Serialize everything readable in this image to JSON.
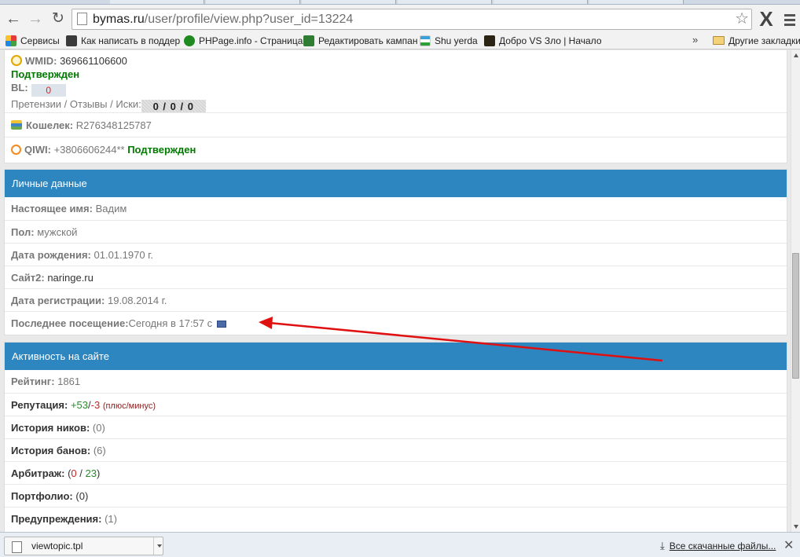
{
  "browser": {
    "url_host": "bymas.ru",
    "url_path": "/user/profile/view.php?user_id=13224",
    "bookmarks": [
      {
        "label": "Сервисы",
        "icon": "apps-grid-icon",
        "color": "#d9534f"
      },
      {
        "label": "Как написать в поддер",
        "icon": "gmail-icon",
        "color": "#3a3a3a"
      },
      {
        "label": "PHPage.info - Страница",
        "icon": "phpage-icon",
        "color": "#1f8a1f"
      },
      {
        "label": "Редактировать кампан",
        "icon": "edit-campaign-icon",
        "color": "#2e7d32"
      },
      {
        "label": "Shu yerda",
        "icon": "uzbek-flag-icon",
        "color": "#3aa0d8"
      },
      {
        "label": "Добро VS Зло | Начало",
        "icon": "dobro-zlo-icon",
        "color": "#4a3a20"
      }
    ],
    "more_glyph": "»",
    "other_bookmarks": "Другие закладки"
  },
  "top_section": {
    "wmid_label": "WMID:",
    "wmid_value": "369661106600",
    "wmid_status": "Подтвержден",
    "bl_label": "BL:",
    "bl_value": "0",
    "claims_label": "Претензии / Отзывы / Иски:",
    "claims_value": "0 / 0 / 0",
    "wallet_label": "Кошелек:",
    "wallet_value": "R276348125787",
    "qiwi_label": "QIWI:",
    "qiwi_value": "+3806606244**",
    "qiwi_status": "Подтвержден"
  },
  "personal": {
    "heading": "Личные данные",
    "real_name_label": "Настоящее имя:",
    "real_name_value": "Вадим",
    "gender_label": "Пол:",
    "gender_value": "мужской",
    "birth_label": "Дата рождения:",
    "birth_value": "01.01.1970 г.",
    "site_label": "Сайт2:",
    "site_value": "naringe.ru",
    "reg_label": "Дата регистрации:",
    "reg_value": "19.08.2014 г.",
    "last_visit_label": "Последнее посещение:",
    "last_visit_value": "Сегодня в 17:57 с"
  },
  "activity": {
    "heading": "Активность на сайте",
    "rating_label": "Рейтинг:",
    "rating_value": "1861",
    "reputation_label": "Репутация:",
    "reputation_plus": "+53",
    "reputation_slash": "/",
    "reputation_minus": "-3",
    "reputation_note": "(плюс/минус)",
    "nick_history_label": "История ников:",
    "nick_history_value": "(0)",
    "ban_history_label": "История банов:",
    "ban_history_value": "(6)",
    "arbitration_label": "Арбитраж:",
    "arbitration_open": "(",
    "arbitration_lost": "0",
    "arbitration_sep": " / ",
    "arbitration_total": "23",
    "arbitration_close": ")",
    "portfolio_label": "Портфолио:",
    "portfolio_value": "(0)",
    "warnings_label": "Предупреждения:",
    "warnings_value": "(1)"
  },
  "downloads": {
    "file_name": "viewtopic.tpl",
    "all_downloads": "Все скачанные файлы...",
    "close_glyph": "✕"
  },
  "colors": {
    "panel_header": "#2e86c1",
    "confirmed_green": "#007a00",
    "annotation_arrow": "#e01010"
  }
}
